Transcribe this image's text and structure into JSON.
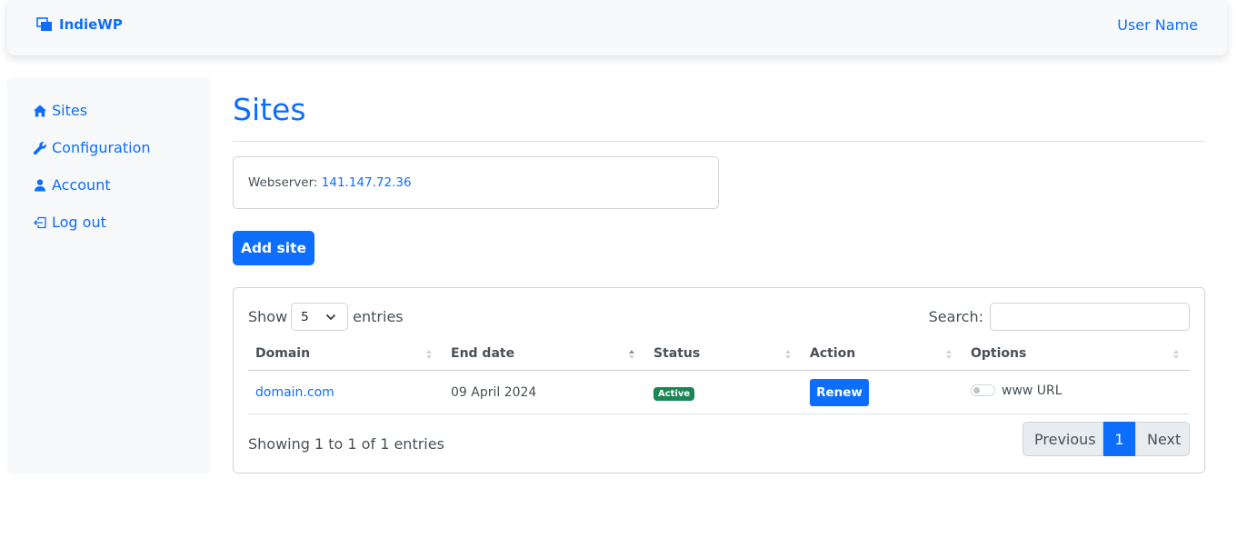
{
  "navbar": {
    "brand": "IndieWP",
    "user": "User Name"
  },
  "sidebar": {
    "items": [
      {
        "label": "Sites",
        "icon": "home-icon"
      },
      {
        "label": "Configuration",
        "icon": "wrench-icon"
      },
      {
        "label": "Account",
        "icon": "person-icon"
      },
      {
        "label": "Log out",
        "icon": "logout-icon"
      }
    ]
  },
  "main": {
    "title": "Sites",
    "webserver_label": "Webserver:",
    "webserver_ip": "141.147.72.36",
    "add_button": "Add site"
  },
  "table": {
    "show_label": "Show",
    "entries_value": "5",
    "entries_label": "entries",
    "search_label": "Search:",
    "search_value": "",
    "columns": [
      "Domain",
      "End date",
      "Status",
      "Action",
      "Options"
    ],
    "rows": [
      {
        "domain": "domain.com",
        "end_date": "09 April 2024",
        "status": "Active",
        "action": "Renew",
        "option_label": "www URL",
        "option_checked": false
      }
    ],
    "info": "Showing 1 to 1 of 1 entries",
    "pagination": {
      "previous": "Previous",
      "current": "1",
      "next": "Next"
    }
  },
  "colors": {
    "primary": "#0d6efd",
    "success": "#198754",
    "background_light": "#f8f9fa"
  }
}
